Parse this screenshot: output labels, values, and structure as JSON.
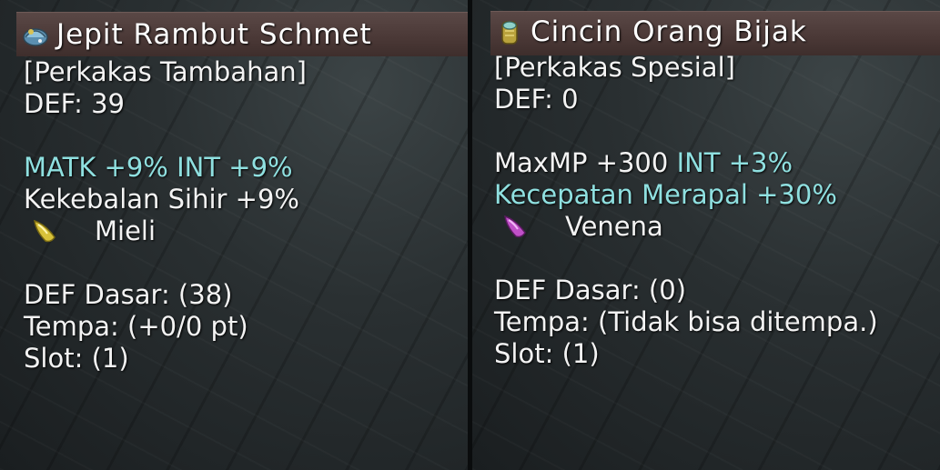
{
  "left": {
    "title": "Jepit Rambut Schmet",
    "icon": "hair-clip-icon",
    "category": "[Perkakas Tambahan]",
    "def": "DEF: 39",
    "bonus_line1_a": "MATK +9%",
    "bonus_line1_b": "INT +9%",
    "bonus_line2": "Kekebalan Sihir +9%",
    "gem_name": "Mieli",
    "gem_color": "#d8c23a",
    "base_def": "DEF Dasar: (38)",
    "refine": "Tempa: (+0/0 pt)",
    "slot": "Slot: (1)"
  },
  "right": {
    "title": "Cincin Orang Bijak",
    "icon": "ring-icon",
    "category": "[Perkakas Spesial]",
    "def": "DEF: 0",
    "bonus_line1_a": "MaxMP +300",
    "bonus_line1_b": "INT +3%",
    "bonus_line2": "Kecepatan Merapal +30%",
    "gem_name": "Venena",
    "gem_color": "#c050c8",
    "base_def": "DEF Dasar: (0)",
    "refine": "Tempa: (Tidak bisa ditempa.)",
    "slot": "Slot: (1)"
  }
}
